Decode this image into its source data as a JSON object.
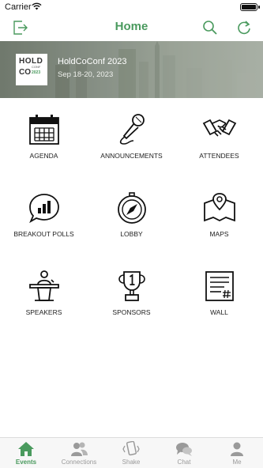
{
  "status_bar": {
    "carrier": "Carrier",
    "time": "",
    "battery_level": 1.0
  },
  "nav": {
    "title": "Home"
  },
  "event": {
    "logo_line1": "HOLD",
    "logo_line2": "CO",
    "logo_small": "CONF",
    "logo_year": "2023",
    "name": "HoldCoConf 2023",
    "dates": "Sep 18-20, 2023"
  },
  "tiles": [
    {
      "label": "AGENDA",
      "icon": "calendar-icon"
    },
    {
      "label": "ANNOUNCEMENTS",
      "icon": "microphone-icon"
    },
    {
      "label": "ATTENDEES",
      "icon": "handshake-icon"
    },
    {
      "label": "BREAKOUT POLLS",
      "icon": "poll-bubble-icon"
    },
    {
      "label": "LOBBY",
      "icon": "compass-icon"
    },
    {
      "label": "MAPS",
      "icon": "map-pin-icon"
    },
    {
      "label": "SPEAKERS",
      "icon": "podium-speaker-icon"
    },
    {
      "label": "SPONSORS",
      "icon": "trophy-icon"
    },
    {
      "label": "WALL",
      "icon": "wall-post-icon"
    }
  ],
  "tabs": [
    {
      "label": "Events",
      "icon": "house-icon",
      "active": true
    },
    {
      "label": "Connections",
      "icon": "people-icon",
      "active": false
    },
    {
      "label": "Shake",
      "icon": "shake-phone-icon",
      "active": false
    },
    {
      "label": "Chat",
      "icon": "chat-bubbles-icon",
      "active": false
    },
    {
      "label": "Me",
      "icon": "person-icon",
      "active": false
    }
  ],
  "colors": {
    "accent": "#4a9a5e",
    "tab_inactive": "#999999",
    "text": "#222222"
  }
}
